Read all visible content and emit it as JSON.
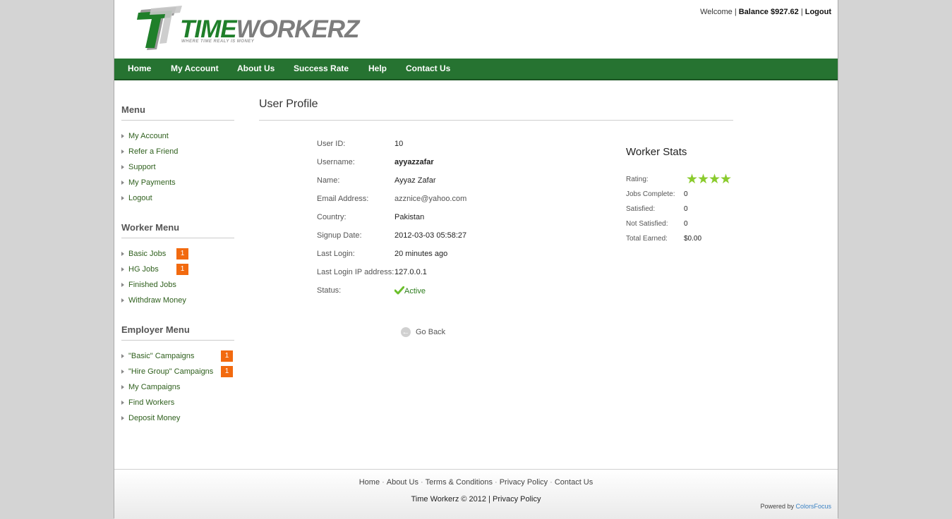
{
  "header": {
    "logo_word_1": "TIME",
    "logo_word_2": "WORKERZ",
    "logo_tagline": "WHERE TIME REALY IS MONEY",
    "welcome": "Welcome",
    "balance": "Balance $927.62",
    "logout": "Logout"
  },
  "nav": [
    {
      "label": "Home"
    },
    {
      "label": "My Account"
    },
    {
      "label": "About Us"
    },
    {
      "label": "Success Rate"
    },
    {
      "label": "Help"
    },
    {
      "label": "Contact Us"
    }
  ],
  "sidebar": {
    "menu": {
      "title": "Menu",
      "items": [
        {
          "label": "My Account"
        },
        {
          "label": "Refer a Friend"
        },
        {
          "label": "Support"
        },
        {
          "label": "My Payments"
        },
        {
          "label": "Logout"
        }
      ]
    },
    "worker_menu": {
      "title": "Worker Menu",
      "items": [
        {
          "label": "Basic Jobs",
          "badge": "1"
        },
        {
          "label": "HG Jobs",
          "badge": "1"
        },
        {
          "label": "Finished Jobs"
        },
        {
          "label": "Withdraw Money"
        }
      ]
    },
    "employer_menu": {
      "title": "Employer Menu",
      "items": [
        {
          "label": "\"Basic\" Campaigns",
          "badge": "1"
        },
        {
          "label": "\"Hire Group\" Campaigns",
          "badge": "1"
        },
        {
          "label": "My Campaigns"
        },
        {
          "label": "Find Workers"
        },
        {
          "label": "Deposit Money"
        }
      ]
    }
  },
  "profile": {
    "title": "User Profile",
    "fields": [
      {
        "label": "User ID:",
        "value": "10"
      },
      {
        "label": "Username:",
        "value": "ayyazzafar"
      },
      {
        "label": "Name:",
        "value": "Ayyaz Zafar"
      },
      {
        "label": "Email Address:",
        "value": "azznice@yahoo.com"
      },
      {
        "label": "Country:",
        "value": "Pakistan"
      },
      {
        "label": "Signup Date:",
        "value": "2012-03-03 05:58:27"
      },
      {
        "label": "Last Login:",
        "value": "20 minutes ago"
      },
      {
        "label": "Last Login IP address:",
        "value": "127.0.0.1"
      },
      {
        "label": "Status:",
        "value": "Active"
      }
    ],
    "go_back": "Go Back"
  },
  "worker_stats": {
    "title": "Worker Stats",
    "rating_label": "Rating:",
    "rating_stars": 4,
    "rows": [
      {
        "label": "Jobs Complete:",
        "value": "0"
      },
      {
        "label": "Satisfied:",
        "value": "0"
      },
      {
        "label": "Not Satisfied:",
        "value": "0"
      },
      {
        "label": "Total Earned:",
        "value": "$0.00"
      }
    ]
  },
  "footer": {
    "links": [
      {
        "label": "Home"
      },
      {
        "label": "About Us"
      },
      {
        "label": "Terms & Conditions"
      },
      {
        "label": "Privacy Policy"
      },
      {
        "label": "Contact Us"
      }
    ],
    "copyright": "Time Workerz © 2012 |",
    "copyright_link": "Privacy Policy",
    "powered_by": "Powered by",
    "powered_link": "ColorsFocus"
  },
  "colors": {
    "nav_bg": "#267331",
    "badge": "#f26a0f",
    "star": "#8acb2d",
    "link_green": "#2e5f1c"
  }
}
